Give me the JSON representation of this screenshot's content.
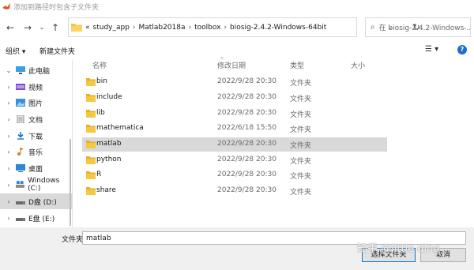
{
  "window": {
    "title": "添加到路径时包含子文件夹"
  },
  "nav": {
    "breadcrumb_prefix": "«",
    "crumbs": [
      "study_app",
      "Matlab2018a",
      "toolbox",
      "biosig-2.4.2-Windows-64bit"
    ],
    "search_placeholder": "在 biosig-2.4.2-Windows-..."
  },
  "toolbar": {
    "organize": "组织 ▾",
    "new_folder": "新建文件夹"
  },
  "sidebar": {
    "items": [
      {
        "label": "此电脑",
        "icon": "computer-icon"
      },
      {
        "label": "视频",
        "icon": "video-icon"
      },
      {
        "label": "图片",
        "icon": "pictures-icon"
      },
      {
        "label": "文档",
        "icon": "documents-icon"
      },
      {
        "label": "下载",
        "icon": "download-icon"
      },
      {
        "label": "音乐",
        "icon": "music-icon"
      },
      {
        "label": "桌面",
        "icon": "desktop-icon"
      },
      {
        "label": "Windows (C:)",
        "icon": "drive-icon"
      },
      {
        "label": "D盘 (D:)",
        "icon": "drive-icon"
      },
      {
        "label": "E盘 (E:)",
        "icon": "drive-icon"
      }
    ]
  },
  "columns": {
    "name": "名称",
    "date": "修改日期",
    "type": "类型",
    "size": "大小"
  },
  "files": [
    {
      "name": "bin",
      "date": "2022/9/28 20:30",
      "type": "文件夹"
    },
    {
      "name": "include",
      "date": "2022/9/28 20:30",
      "type": "文件夹"
    },
    {
      "name": "lib",
      "date": "2022/9/28 20:30",
      "type": "文件夹"
    },
    {
      "name": "mathematica",
      "date": "2022/6/18 15:50",
      "type": "文件夹"
    },
    {
      "name": "matlab",
      "date": "2022/9/28 20:30",
      "type": "文件夹"
    },
    {
      "name": "python",
      "date": "2022/9/28 20:30",
      "type": "文件夹"
    },
    {
      "name": "R",
      "date": "2022/9/28 20:30",
      "type": "文件夹"
    },
    {
      "name": "share",
      "date": "2022/9/28 20:30",
      "type": "文件夹"
    }
  ],
  "selected_index": 4,
  "footer": {
    "filename_label": "文件夹:",
    "filename_value": "matlab",
    "select_button": "选择文件夹",
    "cancel_button": "取消",
    "watermark": "知乎 @little ding"
  },
  "colors": {
    "accent": "#0078d7",
    "folder": "#f5c842",
    "selection": "#d9d9d9"
  }
}
